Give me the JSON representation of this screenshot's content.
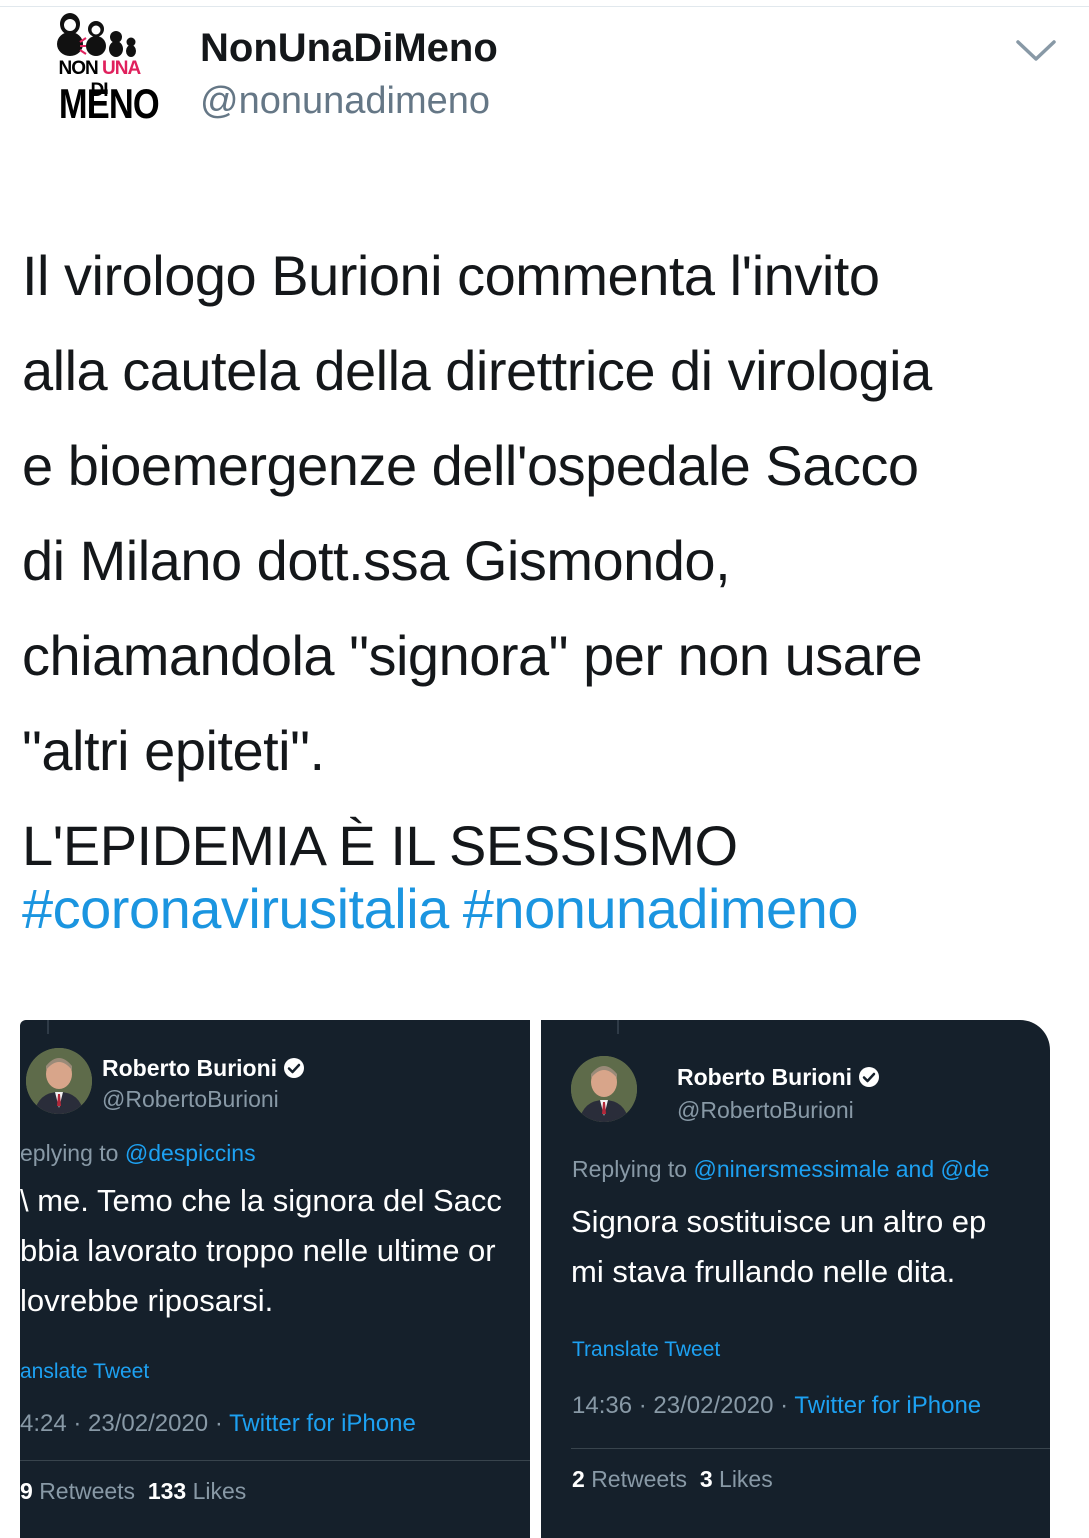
{
  "author": {
    "logo": {
      "line1_a": "NON ",
      "line1_b": "UNA",
      "line1_c": " DI",
      "line2": "MENO",
      "accent_color": "#e0215d"
    },
    "display_name": "NonUnaDiMeno",
    "handle": "@nonunadimeno",
    "menu_icon": "chevron-down-icon"
  },
  "tweet": {
    "lines": [
      "Il virologo Burioni commenta l'invito",
      "alla cautela della direttrice di virologia",
      "e bioemergenze dell'ospedale Sacco",
      "di Milano dott.ssa Gismondo,",
      "chiamandola \"signora\" per non usare",
      "\"altri epiteti\".",
      "L'EPIDEMIA È IL SESSISMO"
    ],
    "hashtags": [
      "#coronavirusitalia",
      "#nonunadimeno"
    ],
    "link_color": "#1b95e0"
  },
  "embedded": [
    {
      "name": "Roberto Burioni",
      "handle": "@RobertoBurioni",
      "verified_icon": "verified-badge-icon",
      "reply_prefix": "eplying to ",
      "reply_mentions": "@despiccins",
      "body": [
        "\\ me. Temo che la signora del Sacc",
        "bbia lavorato troppo nelle ultime or",
        "lovrebbe riposarsi."
      ],
      "translate": "anslate Tweet",
      "time_date": "4:24 · 23/02/2020 · ",
      "source": "Twitter for iPhone",
      "retweets_count": "9",
      "retweets_label": "Retweets",
      "likes_count": "133",
      "likes_label": "Likes"
    },
    {
      "name": "Roberto Burioni",
      "handle": "@RobertoBurioni",
      "verified_icon": "verified-badge-icon",
      "reply_prefix": "Replying to ",
      "reply_mentions": "@ninersmessimale and @de",
      "body": [
        "Signora sostituisce un altro ep",
        "mi stava frullando nelle dita."
      ],
      "translate": "Translate Tweet",
      "time_date": "14:36 · 23/02/2020 · ",
      "source": "Twitter for iPhone",
      "retweets_count": "2",
      "retweets_label": "Retweets",
      "likes_count": "3",
      "likes_label": "Likes"
    }
  ],
  "colors": {
    "embed_background": "#15202b",
    "embed_link": "#1da1f2",
    "muted_text": "#8899a6"
  }
}
